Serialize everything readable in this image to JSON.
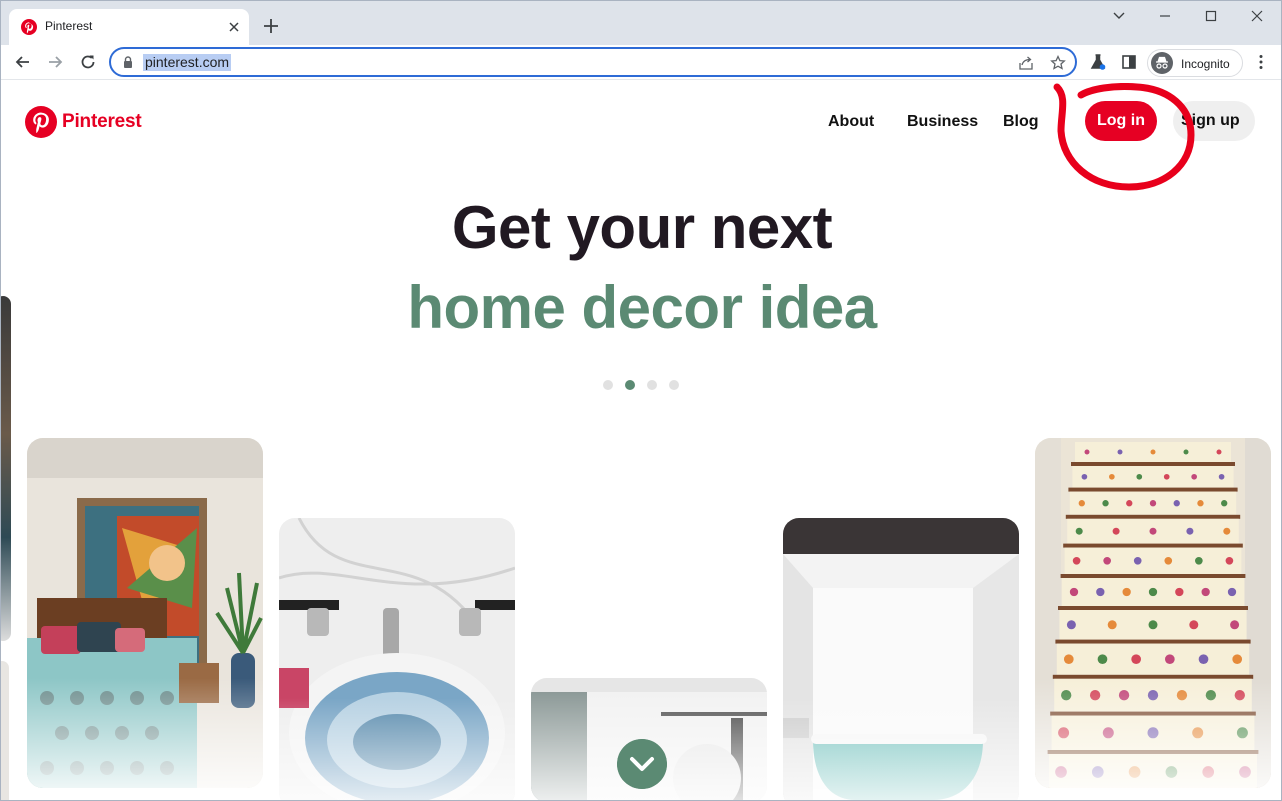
{
  "browser": {
    "tab_title": "Pinterest",
    "url": "pinterest.com",
    "profile_label": "Incognito"
  },
  "site": {
    "logo_text": "Pinterest",
    "nav": {
      "about": "About",
      "business": "Business",
      "blog": "Blog",
      "login": "Log in",
      "signup": "Sign up"
    },
    "headline_line1": "Get your next",
    "headline_line2": "home decor idea",
    "carousel_active_index": 1,
    "carousel_dot_count": 4
  },
  "colors": {
    "brand_red": "#e60023",
    "headline_green": "#5b8a73",
    "annotation_red": "#e8001c"
  }
}
